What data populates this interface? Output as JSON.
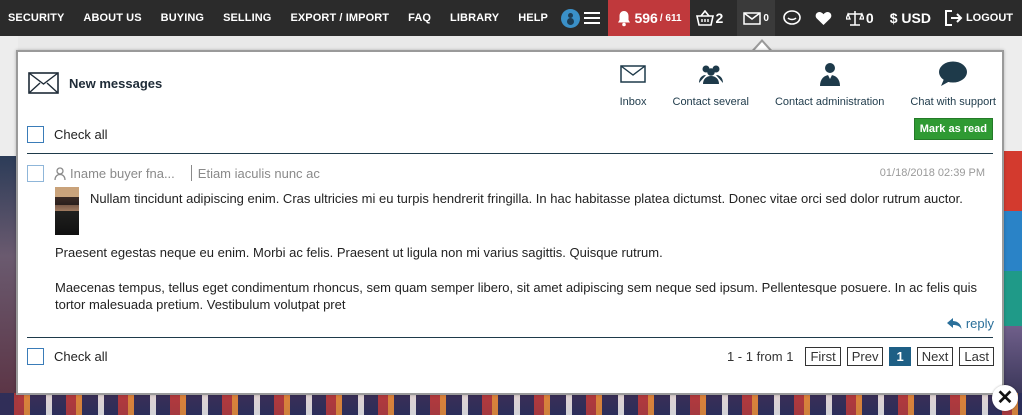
{
  "nav": [
    "SECURITY",
    "ABOUT US",
    "BUYING",
    "SELLING",
    "EXPORT / IMPORT",
    "FAQ",
    "LIBRARY",
    "HELP"
  ],
  "toolbar": {
    "notifications": "596",
    "notifications_total": "/ 611",
    "basket": "2",
    "messages": "0",
    "compare": "0",
    "currency": "$ USD",
    "logout": "LOGOUT"
  },
  "modal": {
    "title": "New messages",
    "actions": [
      {
        "label": "Inbox",
        "icon": "envelope-icon"
      },
      {
        "label": "Contact several",
        "icon": "group-icon"
      },
      {
        "label": "Contact administration",
        "icon": "admin-icon"
      },
      {
        "label": "Chat with support",
        "icon": "chat-bubble-icon"
      }
    ],
    "check_all": "Check all",
    "mark_as_read": "Mark as read",
    "message": {
      "sender": "Iname buyer fna...",
      "subject": "Etiam iaculis nunc ac",
      "date": "01/18/2018 02:39 PM",
      "paragraph1": "Nullam tincidunt adipiscing enim. Cras ultricies mi eu turpis hendrerit fringilla. In hac habitasse platea dictumst. Donec vitae orci sed dolor rutrum auctor.",
      "paragraph2": "Praesent egestas neque eu enim. Morbi ac felis. Praesent ut ligula non mi varius sagittis. Quisque rutrum.",
      "paragraph3": "Maecenas tempus, tellus eget condimentum rhoncus, sem quam semper libero, sit amet adipiscing sem neque sed ipsum. Pellentesque posuere. In ac felis quis tortor malesuada pretium. Vestibulum volutpat pret",
      "reply": "reply"
    },
    "pagination": {
      "info": "1 - 1 from 1",
      "first": "First",
      "prev": "Prev",
      "current": "1",
      "next": "Next",
      "last": "Last"
    }
  },
  "colors": {
    "topbar": "#2b2b2b",
    "notification_bg": "#c0393c",
    "mark_read_bg": "#2f9a33",
    "active_page": "#1e5f85",
    "link": "#2a6f9a"
  }
}
